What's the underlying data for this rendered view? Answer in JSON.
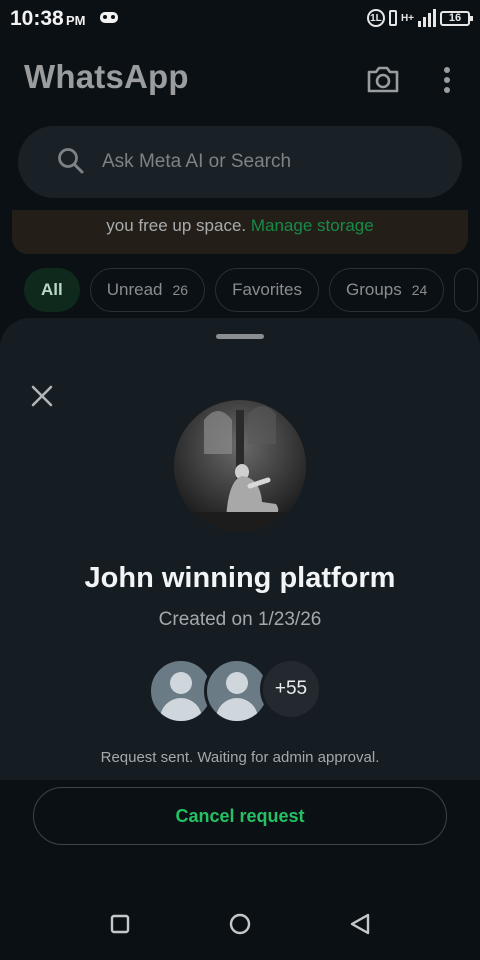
{
  "status_bar": {
    "time": "10:38",
    "ampm": "PM",
    "ring_label": "1L",
    "network_label": "H+",
    "battery": "16"
  },
  "app": {
    "title": "WhatsApp",
    "camera_icon": "camera-icon",
    "menu_icon": "more-vertical-icon"
  },
  "search": {
    "placeholder": "Ask Meta AI or Search"
  },
  "storage_banner": {
    "text": "you free up space.",
    "link": "Manage storage",
    "link_color": "#178a48"
  },
  "filters": [
    {
      "label": "All",
      "count": "",
      "active": true
    },
    {
      "label": "Unread",
      "count": "26",
      "active": false
    },
    {
      "label": "Favorites",
      "count": "",
      "active": false
    },
    {
      "label": "Groups",
      "count": "24",
      "active": false
    }
  ],
  "sheet": {
    "close_icon": "close-icon",
    "group_name": "John winning platform",
    "created": "Created on 1/23/26",
    "members_more": "+55",
    "status": "Request sent. Waiting for admin approval.",
    "cancel_label": "Cancel request",
    "accent": "#25c063"
  },
  "nav": {
    "recents_icon": "square-icon",
    "home_icon": "circle-icon",
    "back_icon": "back-triangle-icon"
  }
}
